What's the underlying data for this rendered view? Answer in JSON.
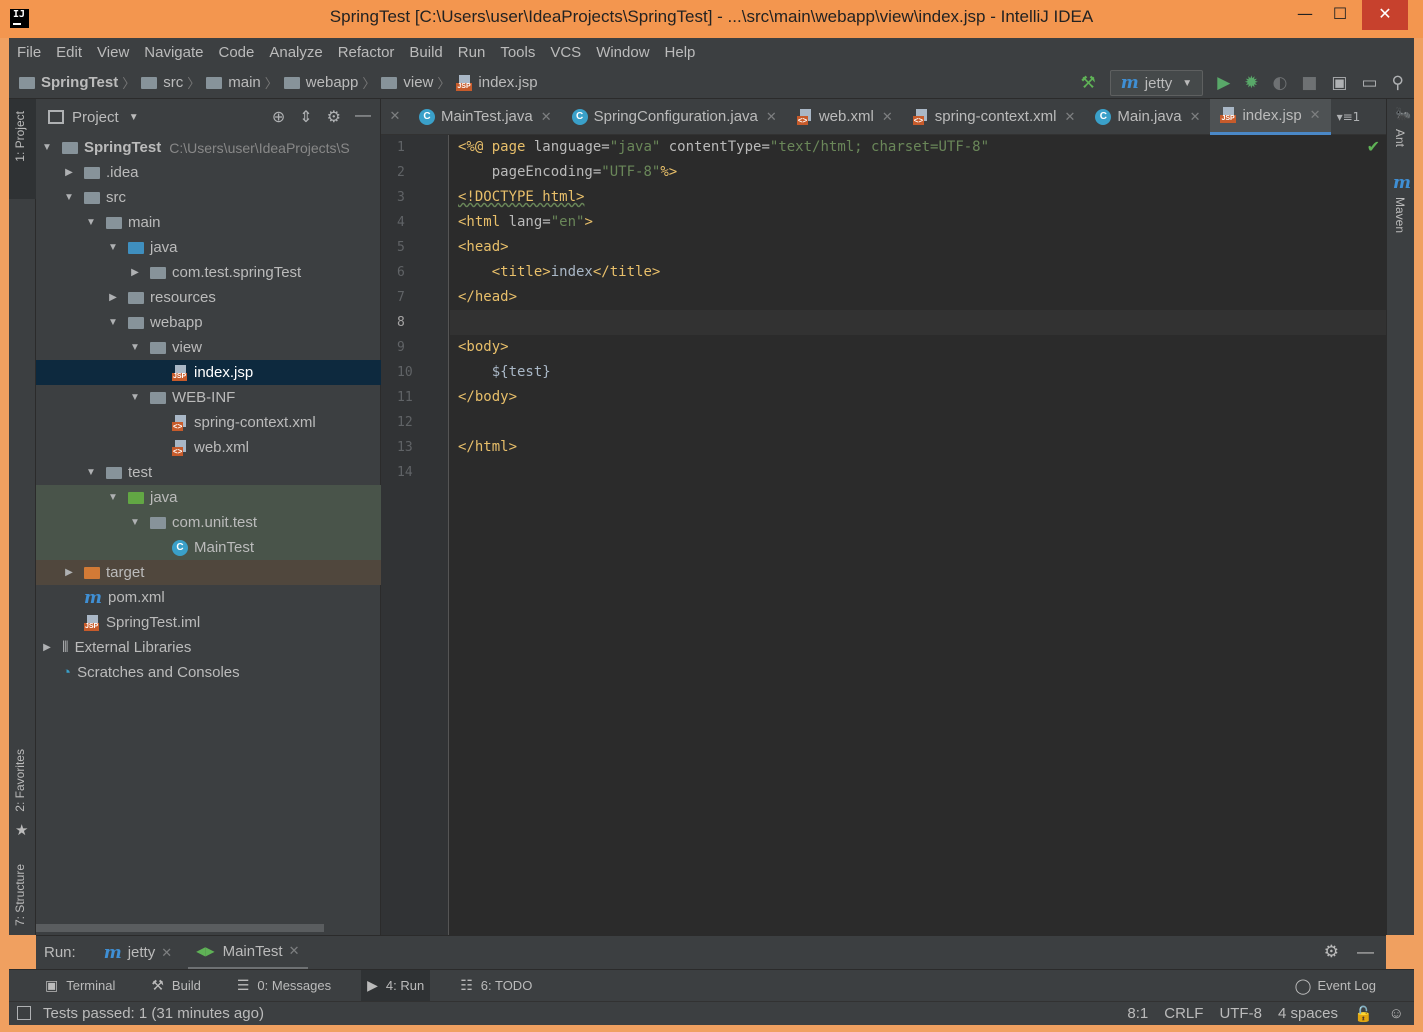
{
  "window": {
    "title": "SpringTest [C:\\Users\\user\\IdeaProjects\\SpringTest] - ...\\src\\main\\webapp\\view\\index.jsp - IntelliJ IDEA",
    "minimize": "—",
    "maximize": "☐",
    "close": "✕"
  },
  "menu": [
    "File",
    "Edit",
    "View",
    "Navigate",
    "Code",
    "Analyze",
    "Refactor",
    "Build",
    "Run",
    "Tools",
    "VCS",
    "Window",
    "Help"
  ],
  "breadcrumb": [
    "SpringTest",
    "src",
    "main",
    "webapp",
    "view",
    "index.jsp"
  ],
  "toolbar": {
    "run_config": "jetty",
    "dropdown_arrow": "▼"
  },
  "project_panel": {
    "title": "Project",
    "tree": [
      {
        "label": "SpringTest",
        "path": "C:\\Users\\user\\IdeaProjects\\S",
        "icon": "folder-module"
      },
      {
        "label": ".idea",
        "icon": "folder"
      },
      {
        "label": "src",
        "icon": "folder"
      },
      {
        "label": "main",
        "icon": "folder"
      },
      {
        "label": "java",
        "icon": "folder-source"
      },
      {
        "label": "com.test.springTest",
        "icon": "package"
      },
      {
        "label": "resources",
        "icon": "folder-resources"
      },
      {
        "label": "webapp",
        "icon": "folder"
      },
      {
        "label": "view",
        "icon": "folder"
      },
      {
        "label": "index.jsp",
        "icon": "jsp-file"
      },
      {
        "label": "WEB-INF",
        "icon": "folder"
      },
      {
        "label": "spring-context.xml",
        "icon": "xml-file"
      },
      {
        "label": "web.xml",
        "icon": "xml-file"
      },
      {
        "label": "test",
        "icon": "folder"
      },
      {
        "label": "java",
        "icon": "folder-test"
      },
      {
        "label": "com.unit.test",
        "icon": "package"
      },
      {
        "label": "MainTest",
        "icon": "class-file"
      },
      {
        "label": "target",
        "icon": "folder-excluded"
      },
      {
        "label": "pom.xml",
        "icon": "maven-file"
      },
      {
        "label": "SpringTest.iml",
        "icon": "iml-file"
      },
      {
        "label": "External Libraries",
        "icon": "libraries"
      },
      {
        "label": "Scratches and Consoles",
        "icon": "scratches"
      }
    ]
  },
  "left_strip": {
    "project": "1: Project",
    "favorites": "2: Favorites",
    "structure": "7: Structure"
  },
  "right_strip": {
    "ant": "Ant",
    "maven": "Maven"
  },
  "tabs": [
    {
      "label": "MainTest.java"
    },
    {
      "label": "SpringConfiguration.java"
    },
    {
      "label": "web.xml"
    },
    {
      "label": "spring-context.xml"
    },
    {
      "label": "Main.java"
    },
    {
      "label": "index.jsp"
    }
  ],
  "tabs_overflow": "1",
  "line_numbers": [
    "1",
    "2",
    "3",
    "4",
    "5",
    "6",
    "7",
    "8",
    "9",
    "10",
    "11",
    "12",
    "13",
    "14"
  ],
  "code": {
    "l1_a": "<%@ ",
    "l1_b": "page ",
    "l1_c": "language=",
    "l1_d": "\"java\"",
    "l1_e": " contentType=",
    "l1_f": "\"text/html; charset=UTF-8\"",
    "l2_a": "    pageEncoding=",
    "l2_b": "\"UTF-8\"",
    "l2_c": "%>",
    "l3": "<!DOCTYPE html>",
    "l4_a": "<html ",
    "l4_b": "lang=",
    "l4_c": "\"en\"",
    "l4_d": ">",
    "l5": "<head>",
    "l6_a": "    <title>",
    "l6_b": "index",
    "l6_c": "</title>",
    "l7": "</head>",
    "l8": "",
    "l9": "<body>",
    "l10": "    ${test}",
    "l11": "</body>",
    "l12": "",
    "l13": "</html>",
    "l14": ""
  },
  "run_panel": {
    "label": "Run:",
    "tabs": [
      {
        "label": "jetty"
      },
      {
        "label": "MainTest"
      }
    ]
  },
  "tool_windows": [
    {
      "label": "Terminal"
    },
    {
      "label": "Build"
    },
    {
      "label": "0: Messages"
    },
    {
      "label": "4: Run"
    },
    {
      "label": "6: TODO"
    }
  ],
  "event_log": "Event Log",
  "status": {
    "message": "Tests passed: 1 (31 minutes ago)",
    "position": "8:1",
    "line_sep": "CRLF",
    "encoding": "UTF-8",
    "indent": "4 spaces"
  }
}
